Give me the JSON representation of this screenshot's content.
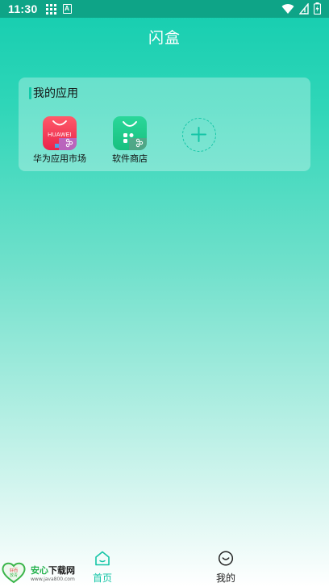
{
  "status_bar": {
    "time": "11:30",
    "a_icon_label": "A",
    "colors": {
      "bar": "#0ea487"
    }
  },
  "header": {
    "title": "闪盒"
  },
  "card": {
    "title": "我的应用",
    "apps": [
      {
        "label": "华为应用市场",
        "icon": "huawei-appgallery-icon",
        "brand_text": "HUAWEI"
      },
      {
        "label": "软件商店",
        "icon": "software-store-icon"
      }
    ],
    "add_icon": "plus-circle-icon"
  },
  "bottom_nav": {
    "items": [
      {
        "label": "首页",
        "icon": "home-icon",
        "active": true
      },
      {
        "label": "我的",
        "icon": "smile-face-icon",
        "active": false
      }
    ],
    "active_color": "#14c5a6"
  },
  "watermark": {
    "name_part1": "安心",
    "name_part2": "下载网",
    "url": "www.java800.com",
    "logo_text_line1": "好而",
    "logo_text_line2": "放青"
  },
  "colors": {
    "accent": "#14c5a6",
    "gradient_top": "#14cdaf"
  }
}
